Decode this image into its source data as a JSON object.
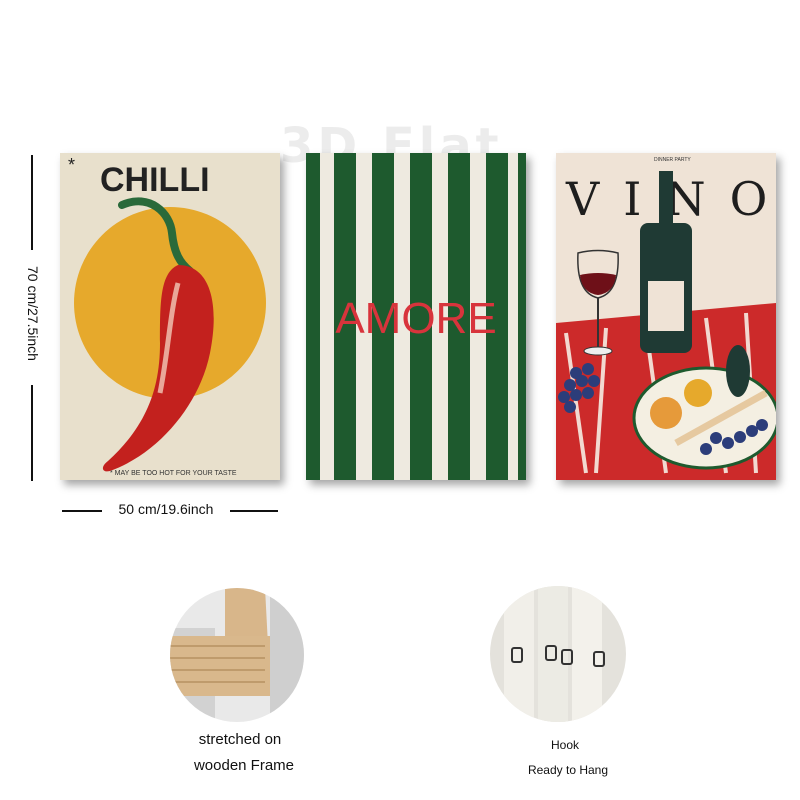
{
  "watermark": "3D Flat",
  "dimensions": {
    "height_label": "70 cm/27.5inch",
    "width_label": "50 cm/19.6inch"
  },
  "posters": [
    {
      "title": "CHILLI",
      "star": "*",
      "subtitle": "* MAY BE TOO HOT FOR YOUR TASTE"
    },
    {
      "title": "AMORE"
    },
    {
      "title": "VINO",
      "subtitle": "DINNER PARTY"
    }
  ],
  "details": [
    {
      "caption_line1": "stretched on",
      "caption_line2": "wooden Frame"
    },
    {
      "caption_line1": "Hook",
      "caption_line2": "Ready to Hang"
    }
  ],
  "colors": {
    "chilli_bg": "#e8e0cc",
    "sun": "#e6a92c",
    "pepper": "#c3211e",
    "stripe_green": "#1e5a2e",
    "amore_red": "#d8343c",
    "vino_bg": "#efe3d6",
    "tablecloth": "#cc2a2a"
  }
}
